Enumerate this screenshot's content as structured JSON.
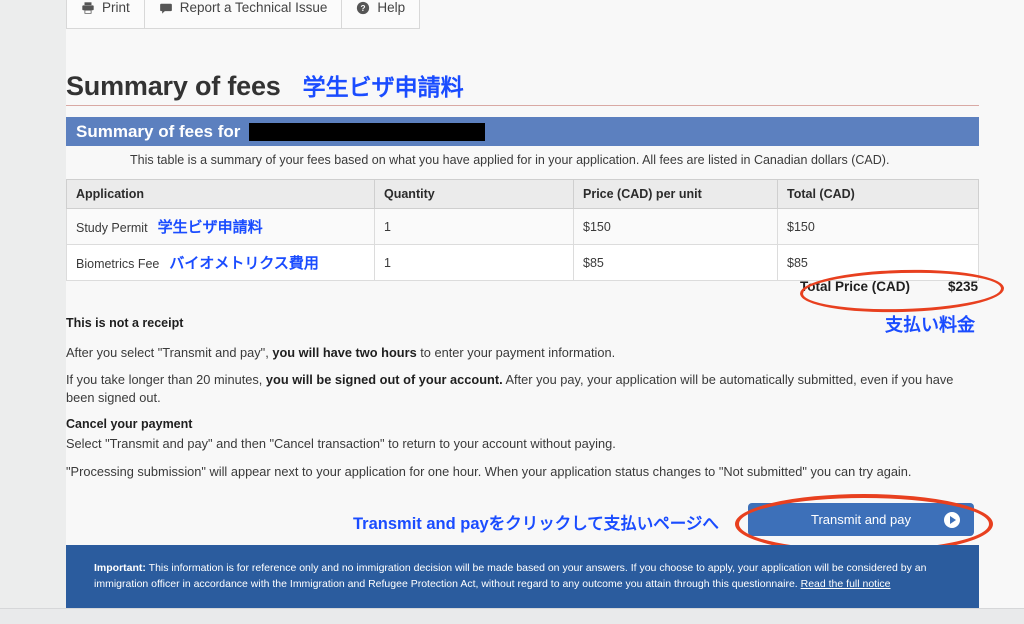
{
  "toolbar": {
    "buttons": [
      {
        "label": "Print",
        "icon": "printer-icon"
      },
      {
        "label": "Report a Technical Issue",
        "icon": "speech-bubble-icon"
      },
      {
        "label": "Help",
        "icon": "question-circle-icon"
      }
    ]
  },
  "page": {
    "title": "Summary of fees",
    "title_annotation_jp": "学生ビザ申請料"
  },
  "summary": {
    "band_title": "Summary of fees for",
    "redacted_name": "",
    "intro": "This table is a summary of your fees based on what you have applied for in your application. All fees are listed in Canadian dollars (CAD)."
  },
  "fee_table": {
    "headers": [
      "Application",
      "Quantity",
      "Price (CAD) per unit",
      "Total (CAD)"
    ],
    "rows": [
      {
        "application": "Study Permit",
        "application_jp": "学生ビザ申請料",
        "quantity": "1",
        "price_per_unit": "$150",
        "total": "$150"
      },
      {
        "application": "Biometrics Fee",
        "application_jp": "バイオメトリクス費用",
        "quantity": "1",
        "price_per_unit": "$85",
        "total": "$85"
      }
    ],
    "total_label": "Total Price (CAD)",
    "total_value": "$235",
    "total_annotation_jp": "支払い料金"
  },
  "notes": {
    "not_a_receipt_heading": "This is not a receipt",
    "two_hours_pre": "After you select \"Transmit and pay\", ",
    "two_hours_bold": "you will have two hours",
    "two_hours_post": " to enter your payment information.",
    "signed_out_pre": "If you take longer than 20 minutes, ",
    "signed_out_bold": "you will be signed out of your account.",
    "signed_out_post": " After you pay, your application will be automatically submitted, even if you have been signed out.",
    "cancel_heading": "Cancel your payment",
    "cancel_text": "Select \"Transmit and pay\" and then \"Cancel transaction\" to return to your account without paying.",
    "processing_text": "\"Processing submission\" will appear next to your application for one hour. When your application status changes to \"Not submitted\" you can try again."
  },
  "action": {
    "annotation_jp": "Transmit and payをクリックして支払いページへ",
    "button_label": "Transmit and pay",
    "button_icon": "play-circle-icon"
  },
  "important": {
    "label": "Important:",
    "text": " This information is for reference only and no immigration decision will be made based on your answers. If you choose to apply, your application will be considered by an immigration officer in accordance with the Immigration and Refugee Protection Act, without regard to any outcome you attain through this questionnaire. ",
    "link": "Read the full notice"
  },
  "colors": {
    "band_blue": "#5c80bf",
    "footer_blue": "#2b5c9e",
    "button_blue": "#3d70b9",
    "annotation_blue": "#1a4cff",
    "annotation_red": "#e8401f",
    "title_rule": "#d9a9a4"
  }
}
